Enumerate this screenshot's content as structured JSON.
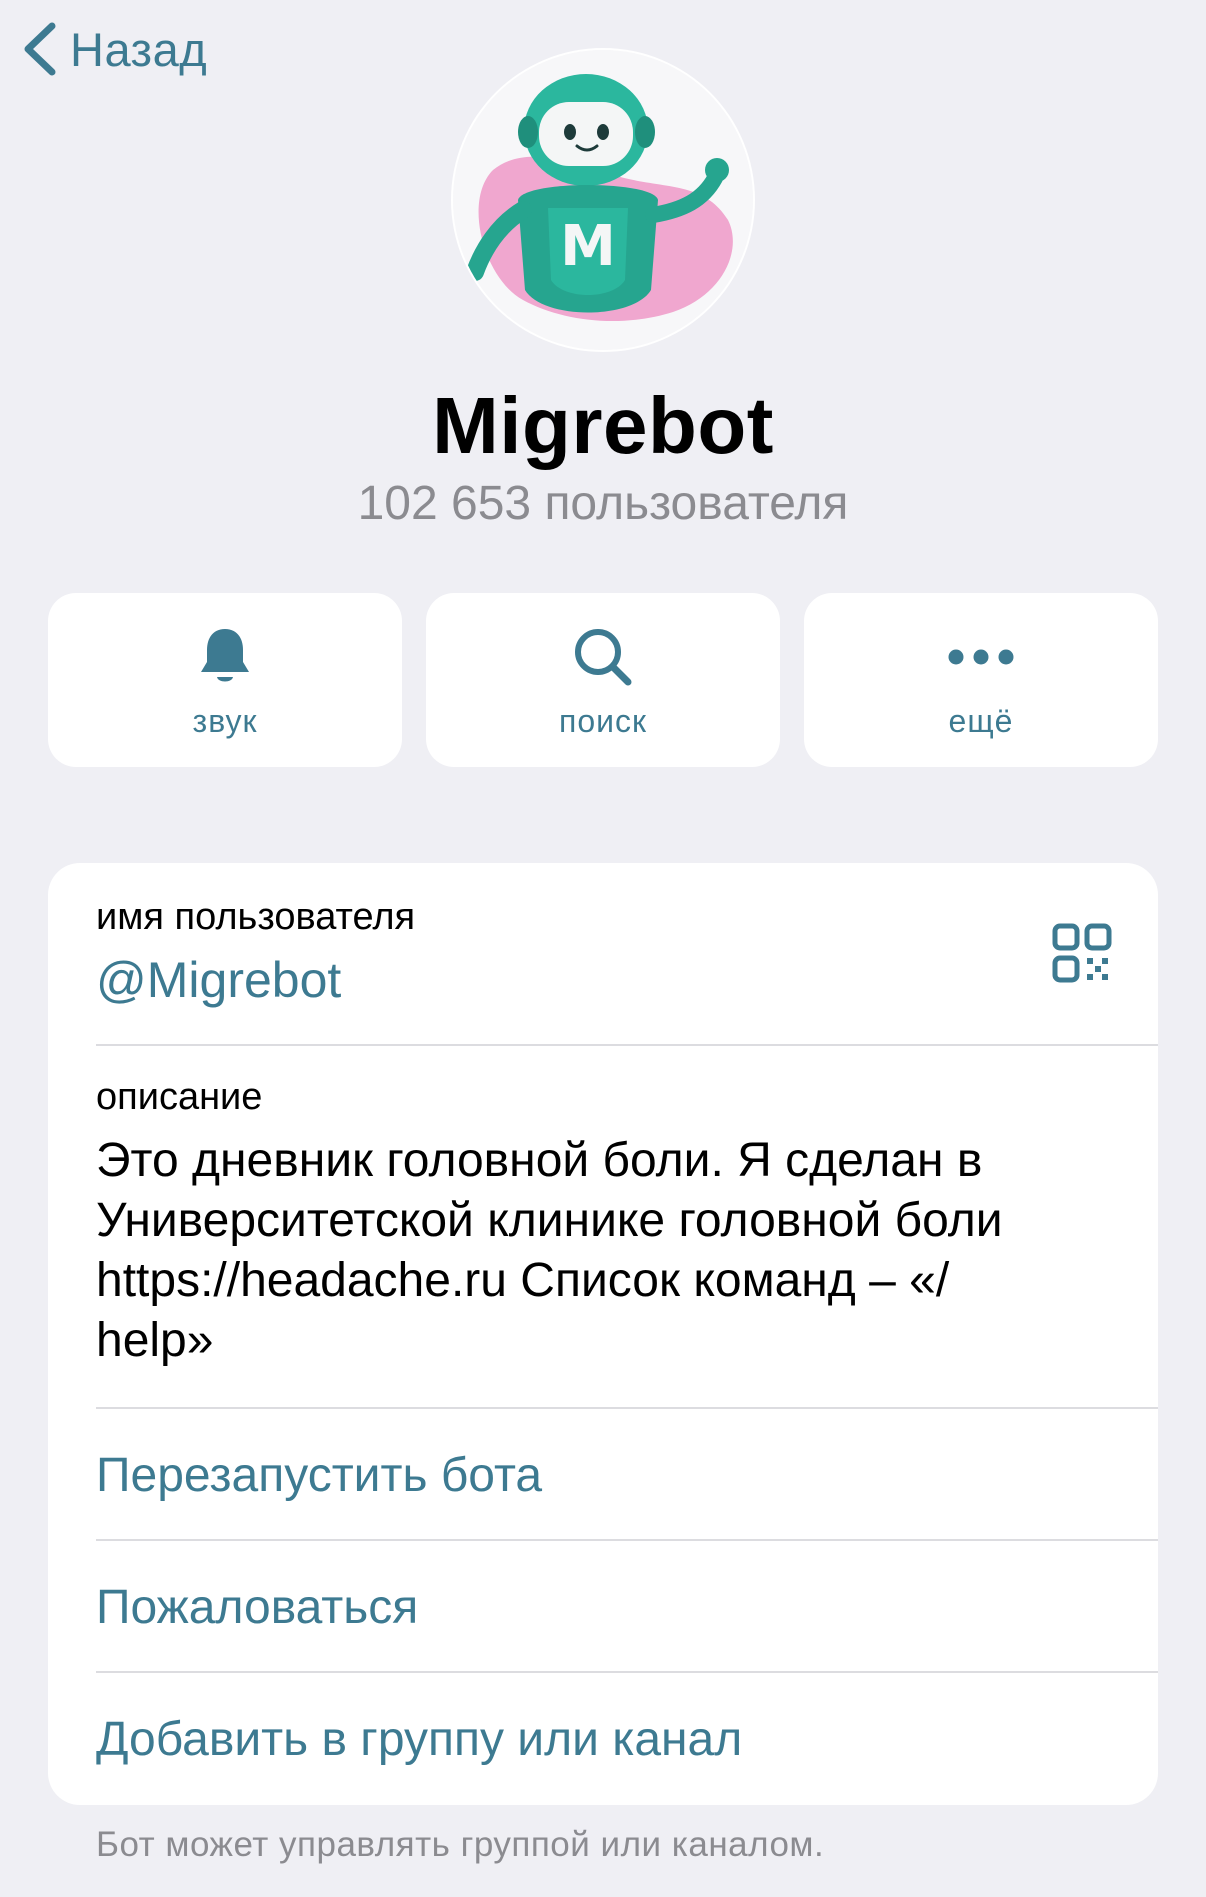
{
  "nav": {
    "back_label": "Назад",
    "back_icon": "chevron-left-icon"
  },
  "profile": {
    "name": "Migrebot",
    "subscribers": "102 653 пользователя",
    "avatar_icon": "robot-avatar",
    "avatar_letter": "M"
  },
  "actions": [
    {
      "label": "звук",
      "icon": "bell-icon"
    },
    {
      "label": "поиск",
      "icon": "search-icon"
    },
    {
      "label": "ещё",
      "icon": "more-icon"
    }
  ],
  "info": {
    "username_caption": "имя пользователя",
    "username_value": "@Migrebot",
    "qr_icon": "qr-code-icon",
    "description_caption": "описание",
    "description_lines": [
      "Это дневник головной боли. Я сделан в",
      "Университетской клинике головной боли",
      "https://headache.ru Список команд – «/",
      "help»"
    ]
  },
  "menu": {
    "restart_label": "Перезапустить бота",
    "report_label": "Пожаловаться",
    "add_label": "Добавить в группу или канал"
  },
  "footer": {
    "note": "Бот может управлять группой или каналом."
  },
  "colors": {
    "background": "#efeff4",
    "accent": "#3d7a91",
    "secondary_text": "#8b8b90",
    "card": "#ffffff",
    "avatar_teal": "#2bb79e",
    "avatar_pink": "#f0a7cf"
  }
}
